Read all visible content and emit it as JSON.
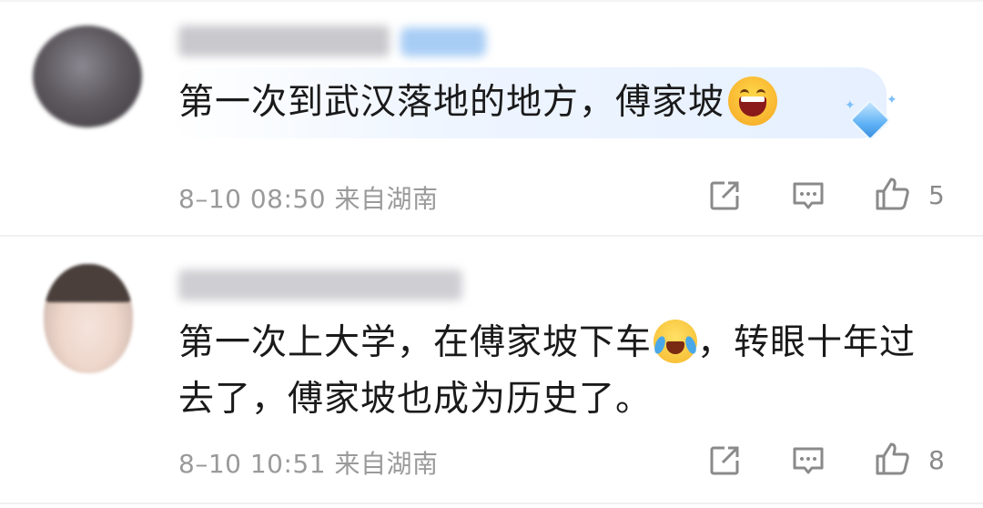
{
  "comments": [
    {
      "text": "第一次到武汉落地的地方，傅家坡",
      "emoji": "laughing-face-icon",
      "time": "8–10 08:50",
      "location": "来自湖南",
      "likes": "5"
    },
    {
      "text": "第一次上大学，在傅家坡下车",
      "emoji": "crying-laughing-face-icon",
      "text_after_emoji": "，转眼十年过去了，傅家坡也成为历史了。",
      "time": "8–10 10:51",
      "location": "来自湖南",
      "likes": "8"
    }
  ],
  "colors": {
    "meta_text": "#9a9a9a",
    "comment_text": "#1a1a1a",
    "bubble": "#eef5ff",
    "icon_gray": "#8a8a8a"
  }
}
